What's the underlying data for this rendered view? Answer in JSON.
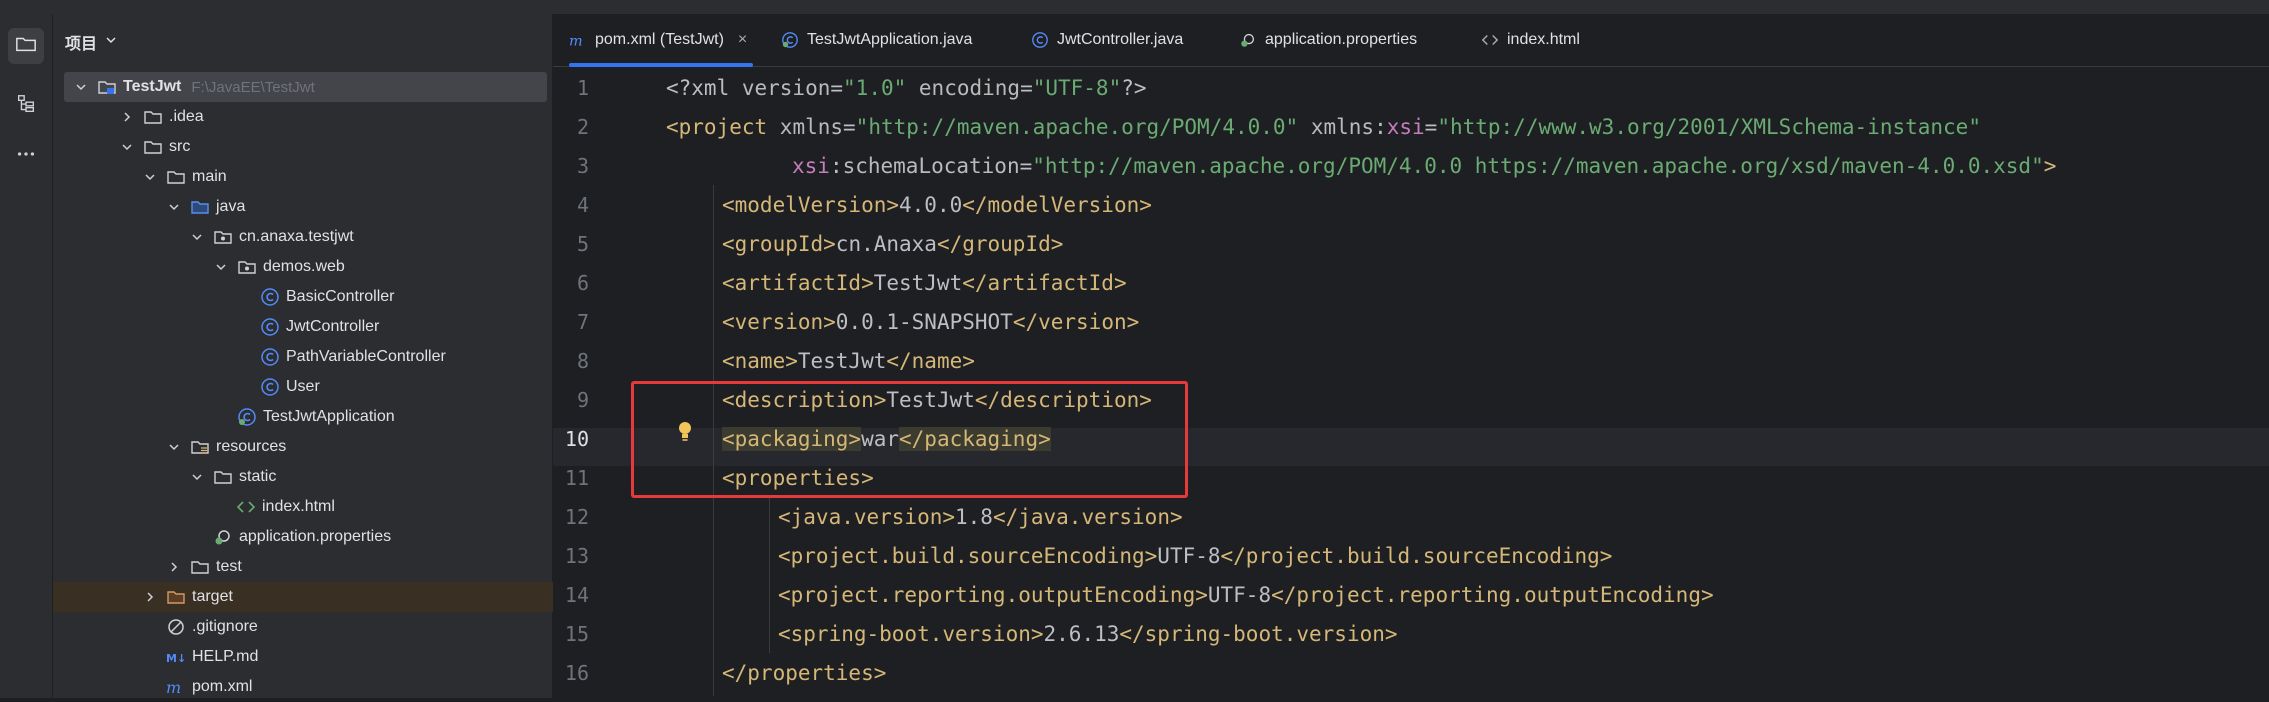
{
  "toolstrip": {
    "icons": [
      "folder-icon",
      "structure-icon",
      "more-icon"
    ]
  },
  "project_panel": {
    "title": "项目",
    "tree": [
      {
        "label": "TestJwt",
        "path": "F:\\JavaEE\\TestJwt",
        "icon": "module-folder-icon"
      },
      {
        "label": ".idea",
        "icon": "folder-icon"
      },
      {
        "label": "src",
        "icon": "folder-icon"
      },
      {
        "label": "main",
        "icon": "folder-icon"
      },
      {
        "label": "java",
        "icon": "source-folder-icon"
      },
      {
        "label": "cn.anaxa.testjwt",
        "icon": "package-icon"
      },
      {
        "label": "demos.web",
        "icon": "package-icon"
      },
      {
        "label": "BasicController",
        "icon": "class-icon"
      },
      {
        "label": "JwtController",
        "icon": "class-icon"
      },
      {
        "label": "PathVariableController",
        "icon": "class-icon"
      },
      {
        "label": "User",
        "icon": "class-icon"
      },
      {
        "label": "TestJwtApplication",
        "icon": "spring-boot-class-icon"
      },
      {
        "label": "resources",
        "icon": "resources-folder-icon"
      },
      {
        "label": "static",
        "icon": "folder-icon"
      },
      {
        "label": "index.html",
        "icon": "html-file-icon"
      },
      {
        "label": "application.properties",
        "icon": "properties-file-icon"
      },
      {
        "label": "test",
        "icon": "folder-icon"
      },
      {
        "label": "target",
        "icon": "excluded-folder-icon"
      },
      {
        "label": ".gitignore",
        "icon": "gitignore-icon"
      },
      {
        "label": "HELP.md",
        "icon": "markdown-icon"
      },
      {
        "label": "pom.xml",
        "icon": "maven-icon"
      }
    ]
  },
  "tabs": [
    {
      "label": "pom.xml (TestJwt)",
      "icon": "maven-icon",
      "close": "×",
      "active": true
    },
    {
      "label": "TestJwtApplication.java",
      "icon": "spring-boot-class-icon"
    },
    {
      "label": "JwtController.java",
      "icon": "class-icon"
    },
    {
      "label": "application.properties",
      "icon": "properties-file-icon"
    },
    {
      "label": "index.html",
      "icon": "html-file-icon"
    }
  ],
  "editor": {
    "line_numbers": [
      "1",
      "2",
      "3",
      "4",
      "5",
      "6",
      "7",
      "8",
      "9",
      "10",
      "11",
      "12",
      "13",
      "14",
      "15",
      "16"
    ],
    "current_line": "10",
    "lines": {
      "l1": {
        "pi_open": "<?xml ",
        "a1": "version",
        "eq1": "=",
        "s1": "\"1.0\"",
        "sp": " ",
        "a2": "encoding",
        "eq2": "=",
        "s2": "\"UTF-8\"",
        "pi_close": "?>"
      },
      "l2": {
        "open": "<project ",
        "a1": "xmlns",
        "eq1": "=",
        "s1": "\"http://maven.apache.org/POM/4.0.0\"",
        "sp": " ",
        "a2": "xmlns",
        "colon": ":",
        "ns": "xsi",
        "eq2": "=",
        "s2": "\"http://www.w3.org/2001/XMLSchema-instance\""
      },
      "l3": {
        "ns": "xsi",
        "colon": ":",
        "a": "schemaLocation",
        "eq": "=",
        "s": "\"http://maven.apache.org/POM/4.0.0 https://maven.apache.org/xsd/maven-4.0.0.xsd\"",
        "close": ">"
      },
      "l4": {
        "open": "<modelVersion>",
        "val": "4.0.0",
        "close": "</modelVersion>"
      },
      "l5": {
        "open": "<groupId>",
        "val": "cn.Anaxa",
        "close": "</groupId>"
      },
      "l6": {
        "open": "<artifactId>",
        "val": "TestJwt",
        "close": "</artifactId>"
      },
      "l7": {
        "open": "<version>",
        "val": "0.0.1-SNAPSHOT",
        "close": "</version>"
      },
      "l8": {
        "open": "<name>",
        "val": "TestJwt",
        "close": "</name>"
      },
      "l9": {
        "open": "<description>",
        "val": "TestJwt",
        "close": "</description>"
      },
      "l10": {
        "open": "<packaging>",
        "val": "war",
        "close": "</packaging>"
      },
      "l11": {
        "open": "<properties>"
      },
      "l12": {
        "open": "<java.version>",
        "val": "1.8",
        "close": "</java.version>"
      },
      "l13": {
        "open": "<project.build.sourceEncoding>",
        "val": "UTF-8",
        "close": "</project.build.sourceEncoding>"
      },
      "l14": {
        "open": "<project.reporting.outputEncoding>",
        "val": "UTF-8",
        "close": "</project.reporting.outputEncoding>"
      },
      "l15": {
        "open": "<spring-boot.version>",
        "val": "2.6.13",
        "close": "</spring-boot.version>"
      },
      "l16": {
        "close": "</properties>"
      }
    }
  },
  "colors": {
    "accent": "#3574f0",
    "annotation_box": "#e5393a",
    "tag": "#d5b778",
    "string": "#6aab73",
    "namespace": "#c77dbb"
  }
}
